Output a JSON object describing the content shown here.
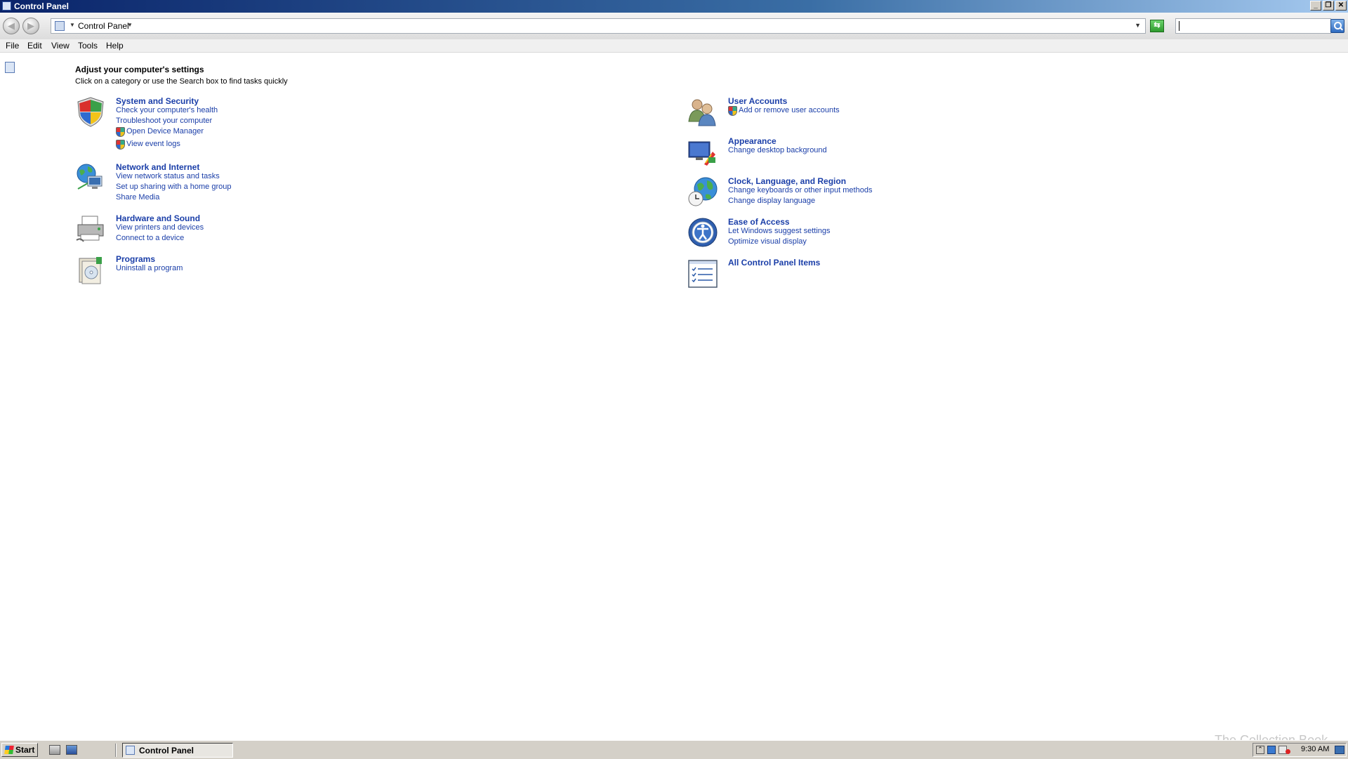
{
  "window": {
    "title": "Control Panel"
  },
  "address": {
    "crumb": "Control Panel",
    "search_placeholder": ""
  },
  "menu": [
    "File",
    "Edit",
    "View",
    "Tools",
    "Help"
  ],
  "heading": {
    "title": "Adjust your computer's settings",
    "subtitle": "Click on a category or use the Search box to find tasks quickly"
  },
  "categories": [
    {
      "title": "System and Security",
      "icon": "shield-icon",
      "links": [
        "Check your computer's health",
        "Troubleshoot your computer",
        "Open Device Manager",
        "View event logs"
      ]
    },
    {
      "title": "Network and Internet",
      "icon": "network-icon",
      "links": [
        "View network status and tasks",
        "Set up sharing with a home group",
        "Share Media"
      ]
    },
    {
      "title": "Hardware and Sound",
      "icon": "printer-icon",
      "links": [
        "View printers and devices",
        "Connect to a device"
      ]
    },
    {
      "title": "Programs",
      "icon": "programs-icon",
      "links": [
        "Uninstall a program"
      ]
    },
    {
      "title": "User Accounts",
      "icon": "users-icon",
      "links": [
        "Add or remove user accounts"
      ]
    },
    {
      "title": "Appearance",
      "icon": "appearance-icon",
      "links": [
        "Change desktop background"
      ]
    },
    {
      "title": "Clock, Language, and Region",
      "icon": "globe-clock-icon",
      "links": [
        "Change keyboards or other input methods",
        "Change display language"
      ]
    },
    {
      "title": "Ease of Access",
      "icon": "ease-of-access-icon",
      "links": [
        "Let Windows suggest settings",
        "Optimize visual display"
      ]
    },
    {
      "title": "All Control Panel Items",
      "icon": "checklist-icon",
      "links": []
    }
  ],
  "taskbar": {
    "start_label": "Start",
    "task_label": "Control Panel",
    "clock": "9:30 AM",
    "watermark": "The Collection Book"
  }
}
